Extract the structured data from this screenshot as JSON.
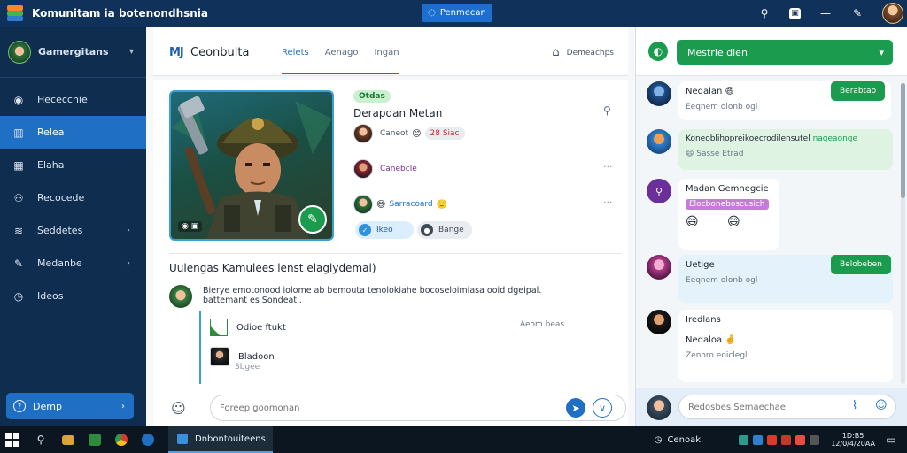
{
  "app": {
    "title": "Komunitam ia botenondhsnia",
    "center_button": "Penmecan"
  },
  "sidebar": {
    "user_name": "Gamergitans",
    "items": [
      {
        "label": "Hececchie",
        "icon": "palette-icon"
      },
      {
        "label": "Relea",
        "icon": "book-icon"
      },
      {
        "label": "Elaha",
        "icon": "calendar-icon"
      },
      {
        "label": "Recocede",
        "icon": "users-icon"
      },
      {
        "label": "Seddetes",
        "icon": "layers-icon"
      },
      {
        "label": "Medanbe",
        "icon": "pen-icon"
      },
      {
        "label": "Ideos",
        "icon": "clock-icon"
      }
    ],
    "footer_label": "Demp"
  },
  "main": {
    "logo": "MJ",
    "title": "Ceonbulta",
    "tabs": [
      "Relets",
      "Aenago",
      "Ingan"
    ],
    "header_right": "Demeachps",
    "profile_badge": "Otdas",
    "profile_name": "Derapdan Metan",
    "members": [
      {
        "label": "Caneot",
        "chip": "28 Siac"
      },
      {
        "label": "Canebcle",
        "chip": ""
      },
      {
        "label": "Sarracoard",
        "chip": ""
      }
    ],
    "chip_blue": "Ikeo",
    "chip_grey": "Bange",
    "post_heading": "Uulengas Kamulees lenst elaglydemai)",
    "post_text": "Bierye emotonood iolome ab bemouta tenolokiahe bocoseloimiasa ooid dgeipal. battemant es Sondeati.",
    "thread_file_title": "Odioe ftukt",
    "thread_file_right": "Aeom beas",
    "thread_user_title": "Bladoon",
    "thread_user_sub": "Sbgee",
    "composer_placeholder": "Foreep goomonan"
  },
  "chat": {
    "dropdown_label": "Mestrie dien",
    "messages": [
      {
        "name": "Nedalan",
        "sub": "Eeqnem olonb ogl",
        "button": "Berabtao",
        "bubble": "white"
      },
      {
        "name": "Koneoblihopreikoecrodilensutel",
        "name_accent": "nageaonge",
        "sub": "Sasse Etrad",
        "bubble": "green"
      },
      {
        "name": "Madan Gemnegcie",
        "tag": "Elocboneboscusich",
        "emojis": "😄 😄",
        "bubble": "white"
      },
      {
        "name": "Uetige",
        "sub": "Eeqnem olonb ogl",
        "button": "Belobeben",
        "bubble": "blue"
      },
      {
        "name": "Iredlans",
        "sub2": "Nedaloa",
        "sub": "Zenoro eoiclegl",
        "bubble": "white"
      }
    ],
    "compose_placeholder": "Redosbes Semaechae."
  },
  "taskbar": {
    "active_app": "Dnbontouiteens",
    "tray_label": "Cenoak.",
    "clock_time": "1D:B5",
    "clock_date": "12/0/4/20AA"
  }
}
